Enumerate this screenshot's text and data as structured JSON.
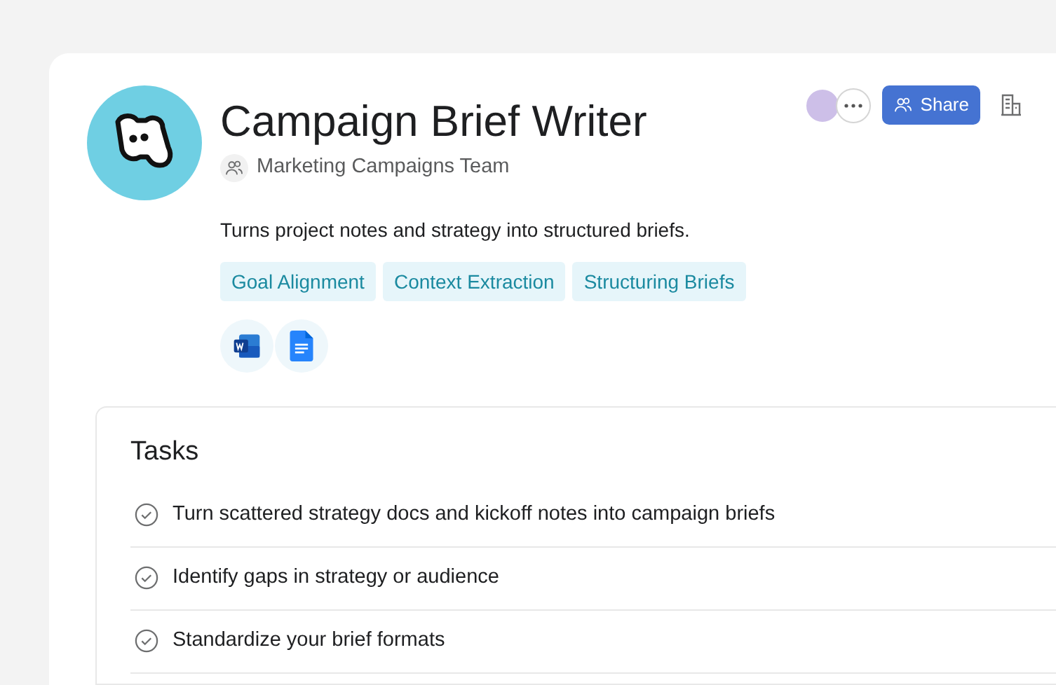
{
  "agent": {
    "title": "Campaign Brief Writer",
    "team": "Marketing Campaigns Team",
    "description": "Turns project notes and strategy into structured briefs.",
    "skills": [
      "Goal Alignment",
      "Context Extraction",
      "Structuring Briefs"
    ],
    "integrations": [
      {
        "kind": "word"
      },
      {
        "kind": "docs"
      }
    ]
  },
  "actions": {
    "share": "Share"
  },
  "tasks": {
    "title": "Tasks",
    "items": [
      {
        "text": "Turn scattered strategy docs and kickoff notes into campaign briefs"
      },
      {
        "text": "Identify gaps in strategy or audience"
      },
      {
        "text": "Standardize your brief formats"
      }
    ]
  }
}
